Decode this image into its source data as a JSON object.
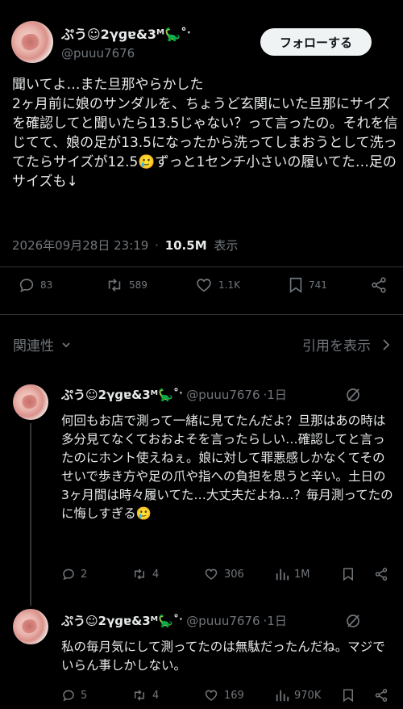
{
  "main_tweet": {
    "display_name": "ぷう☺2γɡɐ&3ᴹ🦕˚ˑ",
    "handle": "@puuu7676",
    "follow_label": "フォローする",
    "text": "聞いてよ…また旦那やらかした\n2ヶ月前に娘のサンダルを、ちょうど玄関にいた旦那にサイズを確認してと聞いたら13.5じゃない？って言ったの。それを信じてて、娘の足が13.5になったから洗ってしまおうとして洗ってたらサイズが12.5🥲ずっと1センチ小さいの履いてた…足のサイズも↓",
    "timestamp": "2026年09月28日 23:19",
    "dot": "·",
    "views": "10.5M",
    "views_label": "表示",
    "stats": {
      "replies": "83",
      "retweets": "589",
      "likes": "1.1K",
      "bookmarks": "741"
    }
  },
  "replies_header": {
    "sort_label": "関連性",
    "quotes_label": "引用を表示"
  },
  "replies": [
    {
      "display_name": "ぷう☺2γɡɐ&3ᴹ🦕˚ˑ",
      "handle": "@puuu7676",
      "time": "·1日",
      "text": "何回もお店で測って一緒に見てたんだよ？旦那はあの時は多分見てなくておおよそを言ったらしい…確認してと言ったのにホント使えねぇ。娘に対して罪悪感しかなくてそのせいで歩き方や足の爪や指への負担を思うと辛い。土日の3ヶ月間は時々履いてた…大丈夫だよね…？毎月測ってたのに悔しすぎる🥲",
      "stats": {
        "replies": "2",
        "retweets": "4",
        "likes": "306",
        "views": "1M"
      }
    },
    {
      "display_name": "ぷう☺2γɡɐ&3ᴹ🦕˚ˑ",
      "handle": "@puuu7676",
      "time": "·1日",
      "text": "私の毎月気にして測ってたのは無駄だったんだね。マジでいらん事しかしない。",
      "stats": {
        "replies": "5",
        "retweets": "4",
        "likes": "169",
        "views": "970K"
      }
    }
  ],
  "icons": {
    "reply": "speech-bubble-icon",
    "retweet": "retweet-arrows-icon",
    "like": "heart-icon",
    "bookmark": "bookmark-icon",
    "share": "share-icon",
    "views": "bar-chart-icon",
    "grok": "grok-icon",
    "chevron_down": "chevron-down-icon",
    "chevron_right": "chevron-right-icon"
  },
  "colors": {
    "background": "#000000",
    "text": "#e7e9ea",
    "secondary": "#71767b",
    "separator": "#2f3336",
    "follow_bg": "#eff3f4"
  }
}
